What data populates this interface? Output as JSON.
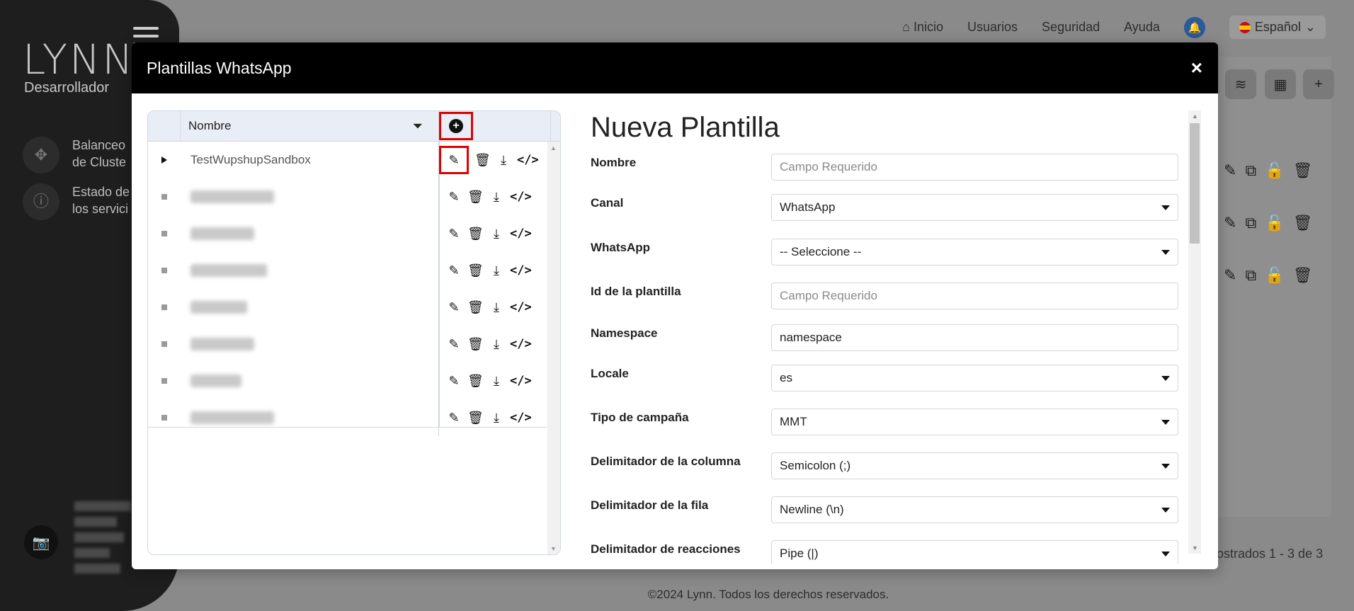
{
  "app": {
    "brand": "LYNN",
    "role": "Desarrollador",
    "sidebar_items": [
      {
        "label_line1": "Balanceo",
        "label_line2": "de Cluste"
      },
      {
        "label_line1": "Estado de",
        "label_line2": "los servici"
      }
    ],
    "nav": {
      "home": "Inicio",
      "users": "Usuarios",
      "security": "Seguridad",
      "help": "Ayuda",
      "language": "Español"
    },
    "footer_count": "ostrados 1 - 3 de 3",
    "copyright": "©2024 Lynn. Todos los derechos reservados."
  },
  "modal": {
    "title": "Plantillas WhatsApp",
    "close": "×"
  },
  "grid": {
    "column_name": "Nombre",
    "rows": [
      {
        "name": "TestWupshupSandbox",
        "expandable": true,
        "redacted": false
      },
      {
        "name": "",
        "expandable": false,
        "redacted": true
      },
      {
        "name": "",
        "expandable": false,
        "redacted": true
      },
      {
        "name": "",
        "expandable": false,
        "redacted": true
      },
      {
        "name": "",
        "expandable": false,
        "redacted": true
      },
      {
        "name": "",
        "expandable": false,
        "redacted": true
      },
      {
        "name": "",
        "expandable": false,
        "redacted": true
      },
      {
        "name": "",
        "expandable": false,
        "redacted": true
      }
    ],
    "actions": [
      "edit-icon",
      "trash-icon",
      "download-icon",
      "code-icon"
    ]
  },
  "form": {
    "title": "Nueva Plantilla",
    "fields": [
      {
        "label": "Nombre",
        "value": "Campo Requerido",
        "placeholder": true,
        "select": false
      },
      {
        "label": "Canal",
        "value": "WhatsApp",
        "placeholder": false,
        "select": true
      },
      {
        "label": "WhatsApp",
        "value": "-- Seleccione --",
        "placeholder": false,
        "select": true
      },
      {
        "label": "Id de la plantilla",
        "value": "Campo Requerido",
        "placeholder": true,
        "select": false
      },
      {
        "label": "Namespace",
        "value": "namespace",
        "placeholder": false,
        "select": false
      },
      {
        "label": "Locale",
        "value": "es",
        "placeholder": false,
        "select": true
      },
      {
        "label": "Tipo de campaña",
        "value": "MMT",
        "placeholder": false,
        "select": true
      },
      {
        "label": "Delimitador de la columna",
        "value": "Semicolon (;)",
        "placeholder": false,
        "select": true
      },
      {
        "label": "Delimitador de la fila",
        "value": "Newline (\\n)",
        "placeholder": false,
        "select": true
      },
      {
        "label": "Delimitador de reacciones",
        "value": "Pipe (|)",
        "placeholder": false,
        "select": true
      }
    ]
  }
}
